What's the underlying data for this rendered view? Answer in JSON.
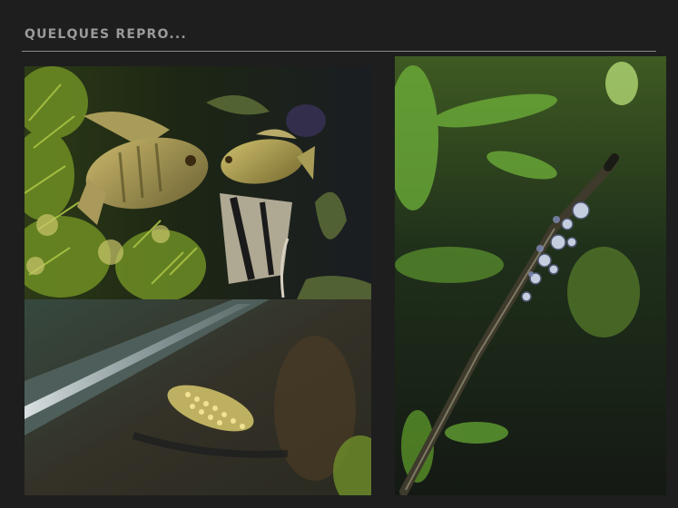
{
  "slide": {
    "title": "QUELQUES REPRO..."
  },
  "photos": [
    {
      "subject": "cichlid fish pair with angelfish among aquarium plants"
    },
    {
      "subject": "fish eggs on a glass surface"
    },
    {
      "subject": "snails on a floating plant stem"
    }
  ]
}
